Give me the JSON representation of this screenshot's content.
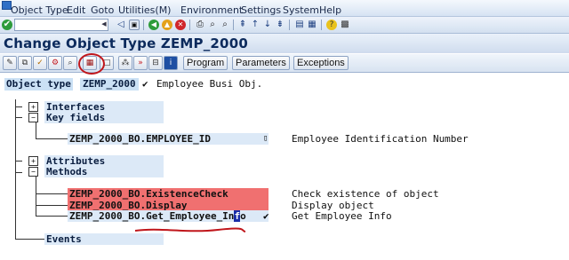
{
  "menubar": {
    "items": [
      "Object Type",
      "Edit",
      "Goto",
      "Utilities(M)",
      "Environment",
      "Settings",
      "System",
      "Help"
    ]
  },
  "systoolbar": {
    "command_value": "",
    "icons": [
      "enter-icon",
      "save-icon",
      "back-icon",
      "exit-icon",
      "cancel-icon",
      "print-icon",
      "find-icon",
      "find-next-icon",
      "first-page-icon",
      "previous-page-icon",
      "next-page-icon",
      "last-page-icon",
      "new-session-icon",
      "shortcut-icon",
      "help-icon",
      "customize-layout-icon"
    ]
  },
  "title": "Change Object Type ZEMP_2000",
  "apptoolbar": {
    "icons": [
      "edit-icon",
      "display-icon",
      "check-icon",
      "test-icon",
      "search-icon",
      "generate-icon",
      "new-icon",
      "where-used-icon",
      "delegate-icon",
      "delete-icon",
      "info-icon"
    ],
    "buttons": [
      "Program",
      "Parameters",
      "Exceptions"
    ]
  },
  "header": {
    "label": "Object type",
    "value": "ZEMP_2000",
    "check": "✔",
    "description": "Employee Busi Obj."
  },
  "tree": {
    "interfaces": "Interfaces",
    "key_fields": "Key fields",
    "key_field_item": "ZEMP_2000_BO.EMPLOYEE_ID",
    "key_field_desc": "Employee Identification Number",
    "attributes": "Attributes",
    "methods": "Methods",
    "method_items": [
      {
        "name": "ZEMP_2000_BO.ExistenceCheck",
        "desc": "Check existence of object"
      },
      {
        "name": "ZEMP_2000_BO.Display",
        "desc": "Display object"
      },
      {
        "name_prefix": "ZEMP_2000_BO.Get_Employee_In",
        "name_cursor": "f",
        "name_suffix": "o",
        "check": "✔",
        "desc": "Get Employee Info"
      }
    ],
    "events": "Events"
  },
  "colors": {
    "highlight_red": "#f07070",
    "band_blue": "#dce9f7",
    "annotation_red": "#c0161b"
  }
}
